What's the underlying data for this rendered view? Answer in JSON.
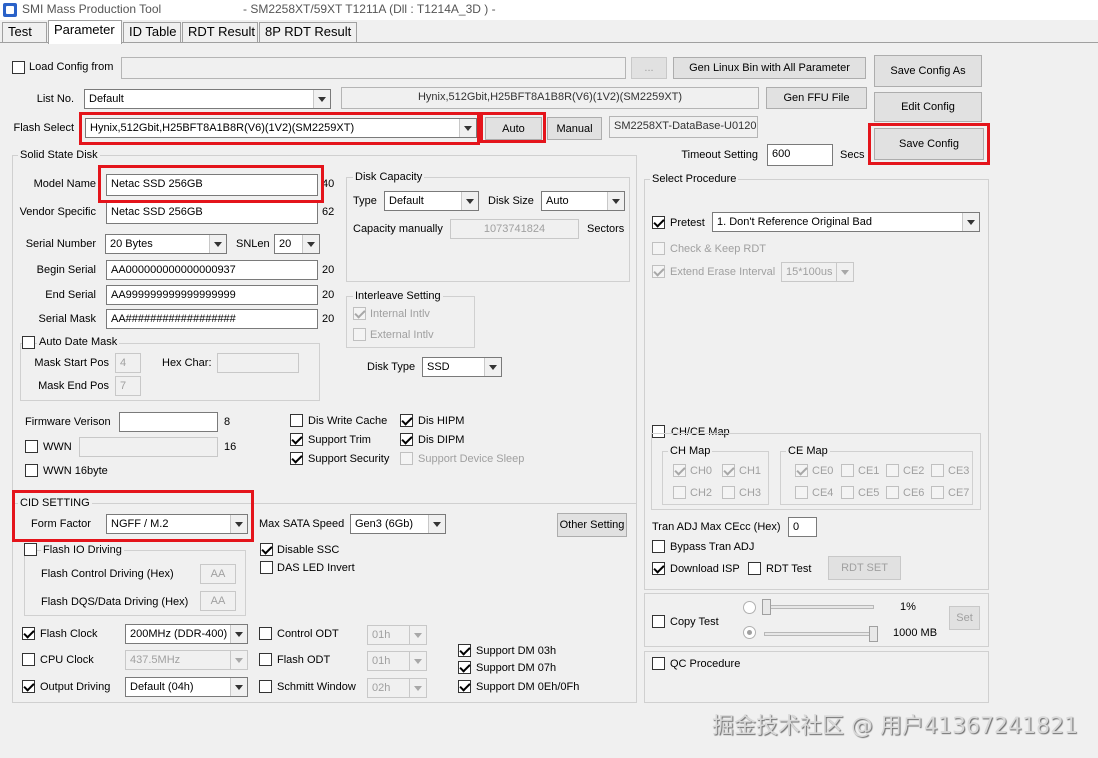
{
  "window": {
    "title": "SMI Mass Production Tool",
    "subtitle": "- SM2258XT/59XT   T1211A     (Dll : T1214A_3D ) -"
  },
  "tabs": [
    "Test",
    "Parameter",
    "ID Table",
    "RDT Result",
    "8P RDT Result"
  ],
  "header": {
    "load_config_label": "Load Config from",
    "load_config_path": "",
    "browse_label": "...",
    "list_no_label": "List No.",
    "list_no_value": "Default",
    "flash_info": "Hynix,512Gbit,H25BFT8A1B8R(V6)(1V2)(SM2259XT)",
    "flash_select_label": "Flash Select",
    "flash_select_value": "Hynix,512Gbit,H25BFT8A1B8R(V6)(1V2)(SM2259XT)",
    "auto_label": "Auto",
    "manual_label": "Manual",
    "database_value": "SM2258XT-DataBase-U0120",
    "gen_linux_label": "Gen Linux Bin with All Parameter",
    "gen_ffu_label": "Gen FFU File",
    "save_config_as_label": "Save Config As",
    "edit_config_label": "Edit Config",
    "save_config_label": "Save Config",
    "timeout_label": "Timeout Setting",
    "timeout_value": "600",
    "timeout_unit": "Secs"
  },
  "ssd": {
    "title": "Solid State Disk",
    "model_name_label": "Model Name",
    "model_name_value": "Netac SSD 256GB",
    "model_name_len": "40",
    "vendor_label": "Vendor Specific",
    "vendor_value": "Netac SSD 256GB",
    "vendor_len": "62",
    "serial_number_label": "Serial Number",
    "serial_number_value": "20 Bytes",
    "snlen_label": "SNLen",
    "snlen_value": "20",
    "begin_serial_label": "Begin Serial",
    "begin_serial_value": "AA000000000000000937",
    "begin_serial_len": "20",
    "end_serial_label": "End Serial",
    "end_serial_value": "AA999999999999999999",
    "end_serial_len": "20",
    "serial_mask_label": "Serial Mask",
    "serial_mask_value": "AA##################",
    "serial_mask_len": "20",
    "auto_date_mask_label": "Auto Date Mask",
    "mask_start_label": "Mask Start Pos",
    "mask_start_value": "4",
    "hex_char_label": "Hex Char:",
    "hex_char_value": "",
    "mask_end_label": "Mask End Pos",
    "mask_end_value": "7",
    "firmware_label": "Firmware Verison",
    "firmware_value": "",
    "firmware_len": "8",
    "wwn_label": "WWN",
    "wwn_value": "",
    "wwn_len": "16",
    "wwn16_label": "WWN 16byte",
    "disk_capacity_title": "Disk Capacity",
    "type_label": "Type",
    "type_value": "Default",
    "disk_size_label": "Disk Size",
    "disk_size_value": "Auto",
    "capacity_manual_label": "Capacity manually",
    "capacity_value": "1073741824",
    "sectors_label": "Sectors",
    "interleave_title": "Interleave Setting",
    "internal_intlv_label": "Internal Intlv",
    "external_intlv_label": "External Intlv",
    "disk_type_label": "Disk Type",
    "disk_type_value": "SSD",
    "dis_write_cache_label": "Dis Write Cache",
    "dis_hipm_label": "Dis HIPM",
    "support_trim_label": "Support Trim",
    "dis_dipm_label": "Dis DIPM",
    "support_security_label": "Support Security",
    "support_device_sleep_label": "Support Device Sleep"
  },
  "cid": {
    "title": "CID SETTING",
    "form_factor_label": "Form Factor",
    "form_factor_value": "NGFF / M.2",
    "max_sata_label": "Max SATA Speed",
    "max_sata_value": "Gen3 (6Gb)",
    "other_setting_label": "Other Setting",
    "flash_io_label": "Flash IO Driving",
    "flash_ctrl_label": "Flash Control Driving (Hex)",
    "flash_ctrl_value": "AA",
    "flash_dqs_label": "Flash DQS/Data Driving (Hex)",
    "flash_dqs_value": "AA",
    "disable_ssc_label": "Disable SSC",
    "das_led_label": "DAS LED Invert",
    "flash_clock_label": "Flash Clock",
    "flash_clock_value": "200MHz (DDR-400)",
    "cpu_clock_label": "CPU Clock",
    "cpu_clock_value": "437.5MHz",
    "output_driving_label": "Output Driving",
    "output_driving_value": "Default (04h)",
    "control_odt_label": "Control ODT",
    "control_odt_value": "01h",
    "flash_odt_label": "Flash ODT",
    "flash_odt_value": "01h",
    "schmitt_label": "Schmitt Window",
    "schmitt_value": "02h",
    "dm03_label": "Support DM 03h",
    "dm07_label": "Support DM 07h",
    "dm0e_label": "Support DM 0Eh/0Fh"
  },
  "procedure": {
    "title": "Select Procedure",
    "pretest_label": "Pretest",
    "pretest_value": "1. Don't Reference Original Bad",
    "check_keep_rdt_label": "Check & Keep RDT",
    "extend_erase_label": "Extend Erase Interval",
    "extend_erase_value": "15*100us",
    "chce_map_label": "CH/CE Map",
    "ch_map_title": "CH Map",
    "ch_labels": [
      "CH0",
      "CH1",
      "CH2",
      "CH3"
    ],
    "ce_map_title": "CE Map",
    "ce_labels": [
      "CE0",
      "CE1",
      "CE2",
      "CE3",
      "CE4",
      "CE5",
      "CE6",
      "CE7"
    ],
    "tran_adj_label": "Tran ADJ Max CEcc (Hex)",
    "tran_adj_value": "0",
    "bypass_tran_label": "Bypass Tran ADJ",
    "download_isp_label": "Download ISP",
    "rdt_test_label": "RDT Test",
    "rdt_set_label": "RDT SET",
    "copy_test_label": "Copy Test",
    "percent_value": "1%",
    "mb_value": "1000 MB",
    "set_label": "Set",
    "qc_procedure_label": "QC Procedure"
  },
  "watermark": "掘金技术社区 @ 用户41367241821"
}
